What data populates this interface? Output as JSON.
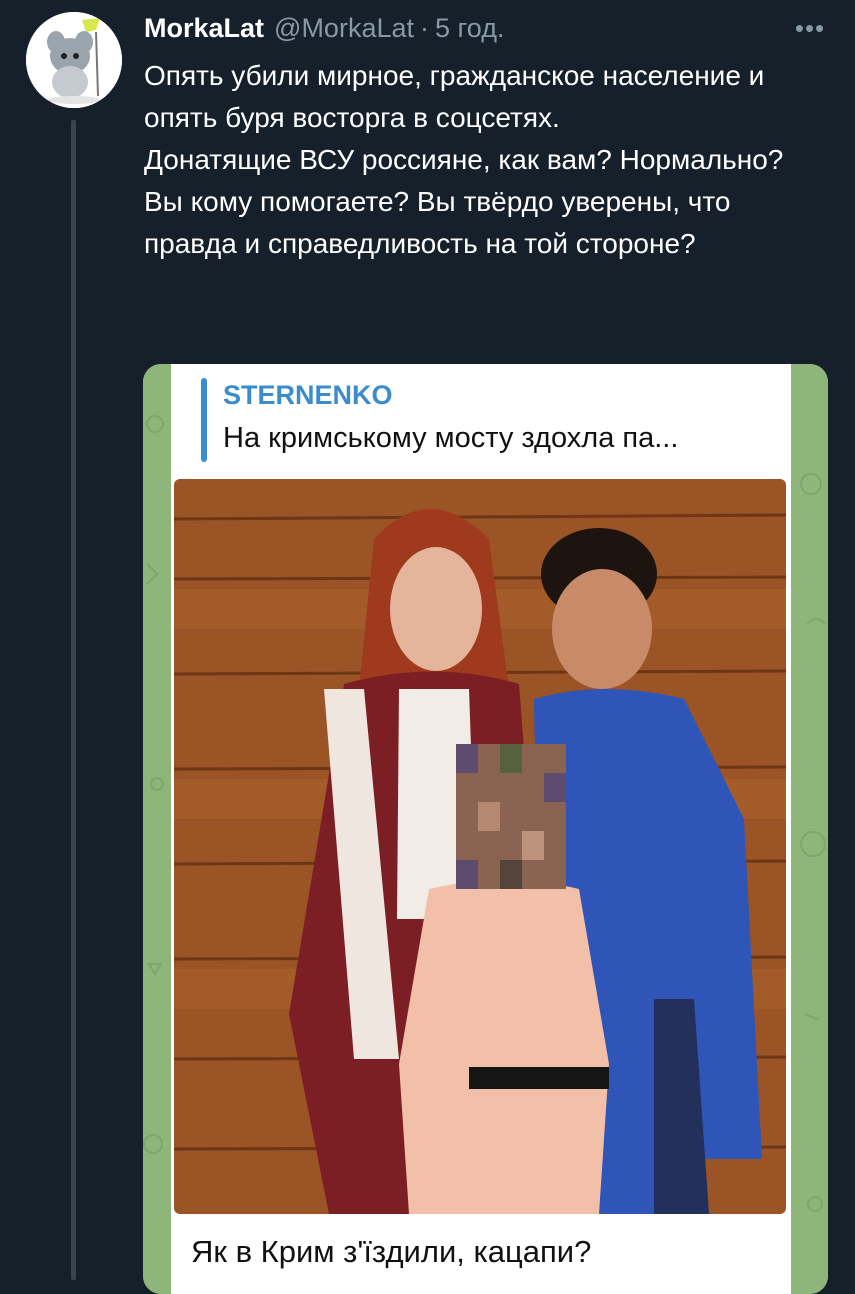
{
  "tweet": {
    "author_name": "MorkaLat",
    "handle": "@MorkaLat",
    "separator": "·",
    "time": "5 год.",
    "more_label": "•••",
    "paragraphs": [
      "Опять убили мирное, гражданское население и опять буря восторга в соцсетях.",
      "Донатящие ВСУ россияне, как вам? Нормально? Вы кому помогаете? Вы твёрдо уверены, что правда и справедливость на той стороне?"
    ]
  },
  "media": {
    "reply_title": "STERNENKO",
    "reply_text": "На кримському мосту здохла па...",
    "caption": "Як в Крим з'їздили, кацапи?"
  },
  "colors": {
    "background": "#15202b",
    "secondary_text": "#8899a6",
    "telegram_accent": "#3a8ccf",
    "telegram_wallpaper": "#8fb67a"
  },
  "icons": {
    "avatar": "cartoon-rat-avatar",
    "more": "more-horizontal-icon"
  }
}
